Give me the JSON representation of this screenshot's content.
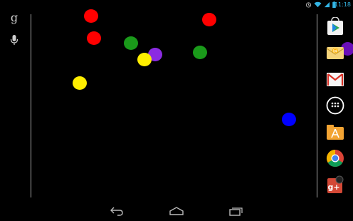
{
  "status_bar": {
    "time": "11:18",
    "icons": [
      "alarm-icon",
      "wifi-icon",
      "cell-signal-icon",
      "battery-icon"
    ],
    "accent_color": "#33b5e5"
  },
  "left_bar": {
    "search_glyph": "g",
    "icons": [
      "google-search-icon",
      "voice-search-icon"
    ]
  },
  "balls": {
    "colors": {
      "red": "#ff0000",
      "green": "#1a9a1a",
      "yellow": "#ffee00",
      "purple": "#8b2be2",
      "blue": "#0000ff"
    }
  },
  "dock": {
    "apps": [
      "play-store-icon",
      "email-icon",
      "gmail-icon",
      "all-apps-icon",
      "files-icon",
      "chrome-icon",
      "google-plus-icon"
    ]
  },
  "nav_bar": {
    "buttons": [
      "back-button",
      "home-button",
      "recents-button"
    ]
  }
}
